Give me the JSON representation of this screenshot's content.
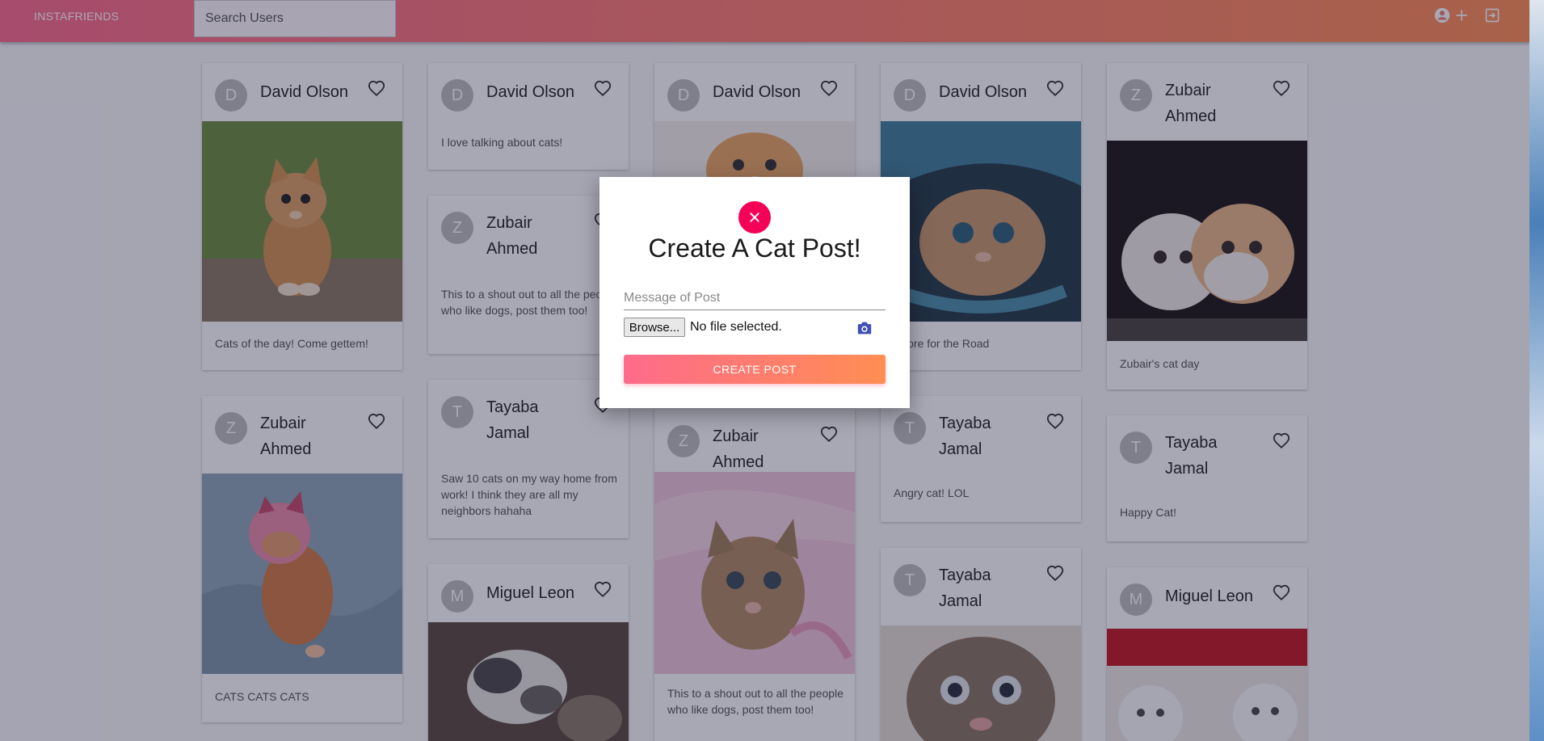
{
  "app": {
    "brand": "INSTAFRIENDS",
    "search_placeholder": "Search Users"
  },
  "colors": {
    "gradient_start": "#fe6b8b",
    "gradient_end": "#ff8e53",
    "close_button": "#f50057",
    "camera_icon": "#3f51b5"
  },
  "header_icons": [
    "account-circle-icon",
    "add-icon",
    "logout-icon"
  ],
  "posts": [
    {
      "author": "David Olson",
      "initial": "D",
      "photo": "orange kitten sitting on grass",
      "caption": "Cats of the day! Come gettem!"
    },
    {
      "author": "Zubair Ahmed",
      "initial": "Z",
      "photo": "orange kitten in pink hat sleeping",
      "caption": "CATS CATS CATS"
    },
    {
      "author": "David Olson",
      "initial": "D",
      "caption": "I love talking about cats!"
    },
    {
      "author": "Zubair Ahmed",
      "initial": "Z",
      "caption": "This to a shout out to all the people who like dogs, post them too!"
    },
    {
      "author": "Tayaba Jamal",
      "initial": "T",
      "caption": "Saw 10 cats on my way home from work! I think they are all my neighbors hahaha"
    },
    {
      "author": "Miguel Leon",
      "initial": "M",
      "photo": "sleeping grey kitten"
    },
    {
      "author": "David Olson",
      "initial": "D",
      "photo": "orange and white kitten"
    },
    {
      "author": "Zubair Ahmed",
      "initial": "Z",
      "photo": "tabby kitten in pink ribbon",
      "caption": "This to a shout out to all the people who like dogs, post them too!"
    },
    {
      "author": "David Olson",
      "initial": "D",
      "photo": "kitten peeking from denim",
      "caption": "Adore for the Road"
    },
    {
      "author": "Tayaba Jamal",
      "initial": "T",
      "caption": "Angry cat! LOL"
    },
    {
      "author": "Tayaba Jamal",
      "initial": "T",
      "photo": "tabby kitten face"
    },
    {
      "author": "Zubair Ahmed",
      "initial": "Z",
      "photo": "two kittens lying together",
      "caption": "Zubair's cat day"
    },
    {
      "author": "Tayaba Jamal",
      "initial": "T",
      "caption": "Happy Cat!"
    },
    {
      "author": "Miguel Leon",
      "initial": "M",
      "photo": "white persian kittens"
    }
  ],
  "modal": {
    "title": "Create A Cat Post!",
    "message_placeholder": "Message of Post",
    "browse_label": "Browse...",
    "file_status": "No file selected.",
    "submit_label": "CREATE POST"
  }
}
